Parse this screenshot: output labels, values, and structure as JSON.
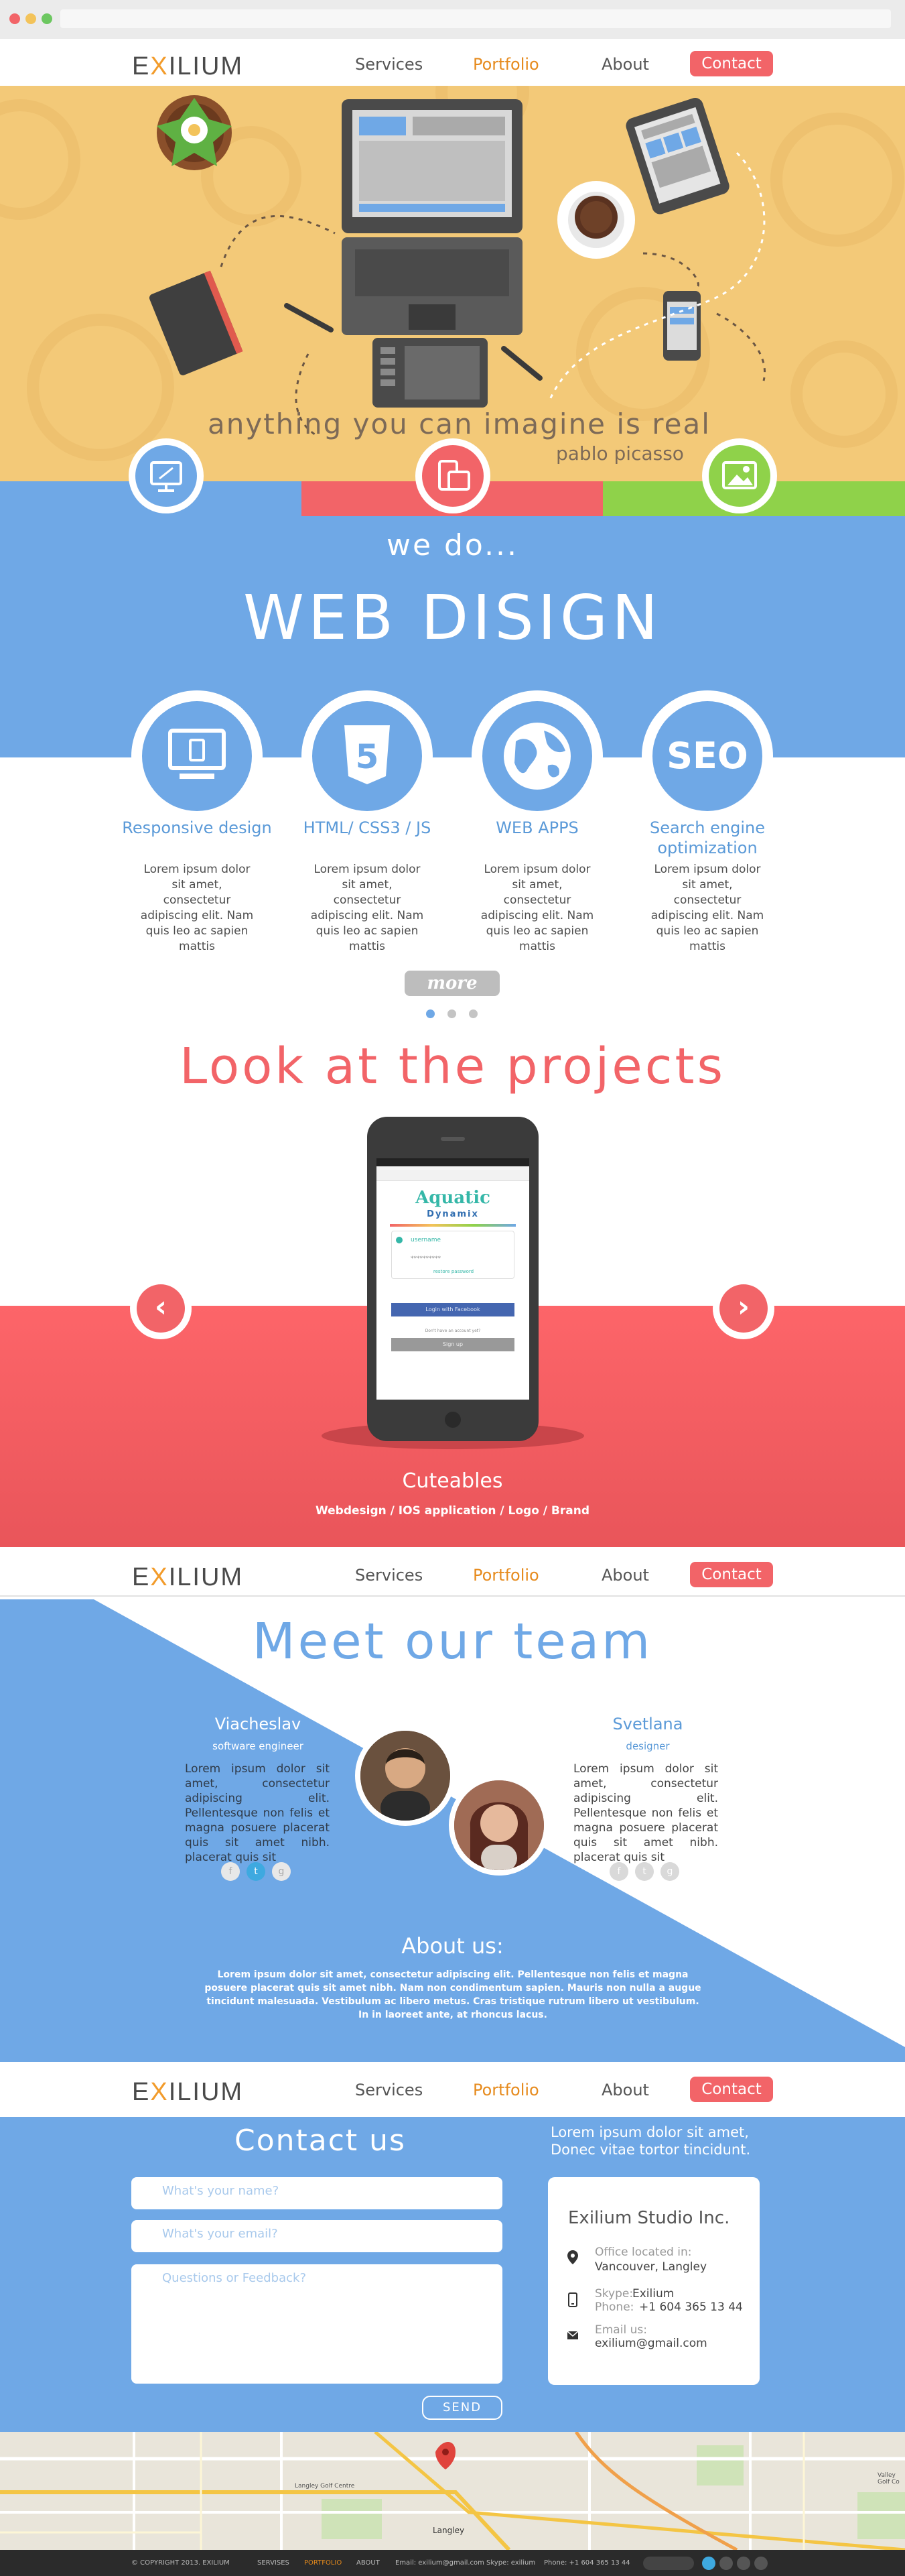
{
  "nav": {
    "logo_prefix": "E",
    "logo_x": "X",
    "logo_suffix": "ILIUM",
    "links": [
      "Services",
      "Portfolio",
      "About",
      "Contact"
    ]
  },
  "hero": {
    "quote": "anything you can imagine is real",
    "author": "pablo picasso"
  },
  "services": {
    "intro": "we do...",
    "headline": "WEB DISIGN",
    "items": [
      {
        "title": "Responsive design",
        "text": "Lorem ipsum dolor sit amet, consectetur adipiscing elit. Nam quis leo ac sapien mattis"
      },
      {
        "title": "HTML/ CSS3 / JS",
        "text": "Lorem ipsum dolor sit amet, consectetur adipiscing elit. Nam quis leo ac sapien mattis"
      },
      {
        "title": "WEB APPS",
        "text": "Lorem ipsum dolor sit amet, consectetur adipiscing elit. Nam quis leo ac sapien mattis"
      },
      {
        "title": "Search engine optimization",
        "text": "Lorem ipsum dolor sit amet, consectetur adipiscing elit. Nam quis leo ac sapien mattis"
      }
    ],
    "seo_icon_text": "SEO",
    "html5_icon_text": "5",
    "more": "more"
  },
  "projects": {
    "title": "Look at the projects",
    "name": "Cuteables",
    "subtitle": "Webdesign / IOS application / Logo / Brand",
    "app": {
      "logo_line1": "Aquatic",
      "logo_line2": "Dynamix",
      "username": "username",
      "password": "**********",
      "forgot": "restore password",
      "facebook": "Login with Facebook",
      "dont_have": "Don't have an account yet?",
      "signup": "Sign up"
    }
  },
  "team": {
    "title": "Meet our team",
    "members": [
      {
        "name": "Viacheslav",
        "role": "software engineer",
        "bio": "Lorem ipsum dolor sit amet, consectetur adipiscing elit. Pellentesque non felis et magna posuere placerat quis sit amet nibh. placerat quis sit"
      },
      {
        "name": "Svetlana",
        "role": "designer",
        "bio": "Lorem ipsum dolor sit amet, consectetur adipiscing elit. Pellentesque non felis et magna posuere placerat quis sit amet nibh. placerat quis sit"
      }
    ],
    "social": [
      "f",
      "t",
      "g"
    ],
    "about_title": "About us:",
    "about_text": "Lorem ipsum dolor sit amet, consectetur adipiscing elit. Pellentesque non felis et magna posuere placerat quis sit amet nibh. Nam non condimentum sapien. Mauris non nulla a augue tincidunt malesuada. Vestibulum ac libero metus. Cras tristique rutrum libero ut vestibulum. In in laoreet ante, at rhoncus lacus."
  },
  "contact": {
    "title": "Contact us",
    "tagline": "Lorem ipsum dolor sit amet, Donec vitae tortor tincidunt.",
    "name_placeholder": "What's your name?",
    "email_placeholder": "What's your email?",
    "message_placeholder": "Questions or Feedback?",
    "send": "SEND",
    "card": {
      "company": "Exilium Studio Inc.",
      "office_label": "Office located in:",
      "office_value": "Vancouver, Langley",
      "skype_label": "Skype:",
      "skype_value": "Exilium",
      "phone_label": "Phone:",
      "phone_value": "+1 604 365 13 44",
      "email_label": "Email us:",
      "email_value": "exilium@gmail.com"
    }
  },
  "map": {
    "labels": [
      "Langley",
      "Langley Golf Centre",
      "Valley Golf Co"
    ]
  },
  "footer": {
    "copyright": "© COPYRIGHT 2013. EXILIUM",
    "links": [
      "SERVISES",
      "PORTFOLIO",
      "ABOUT"
    ],
    "email": "Email: exilium@gmail.com",
    "skype": "Skype: exilium",
    "phone": "Phone: +1 604 365 13 44"
  },
  "colors": {
    "blue": "#6fa8e6",
    "red": "#f26468",
    "orange": "#e68a1c",
    "green": "#8fd24a",
    "sand": "#f3c978"
  }
}
